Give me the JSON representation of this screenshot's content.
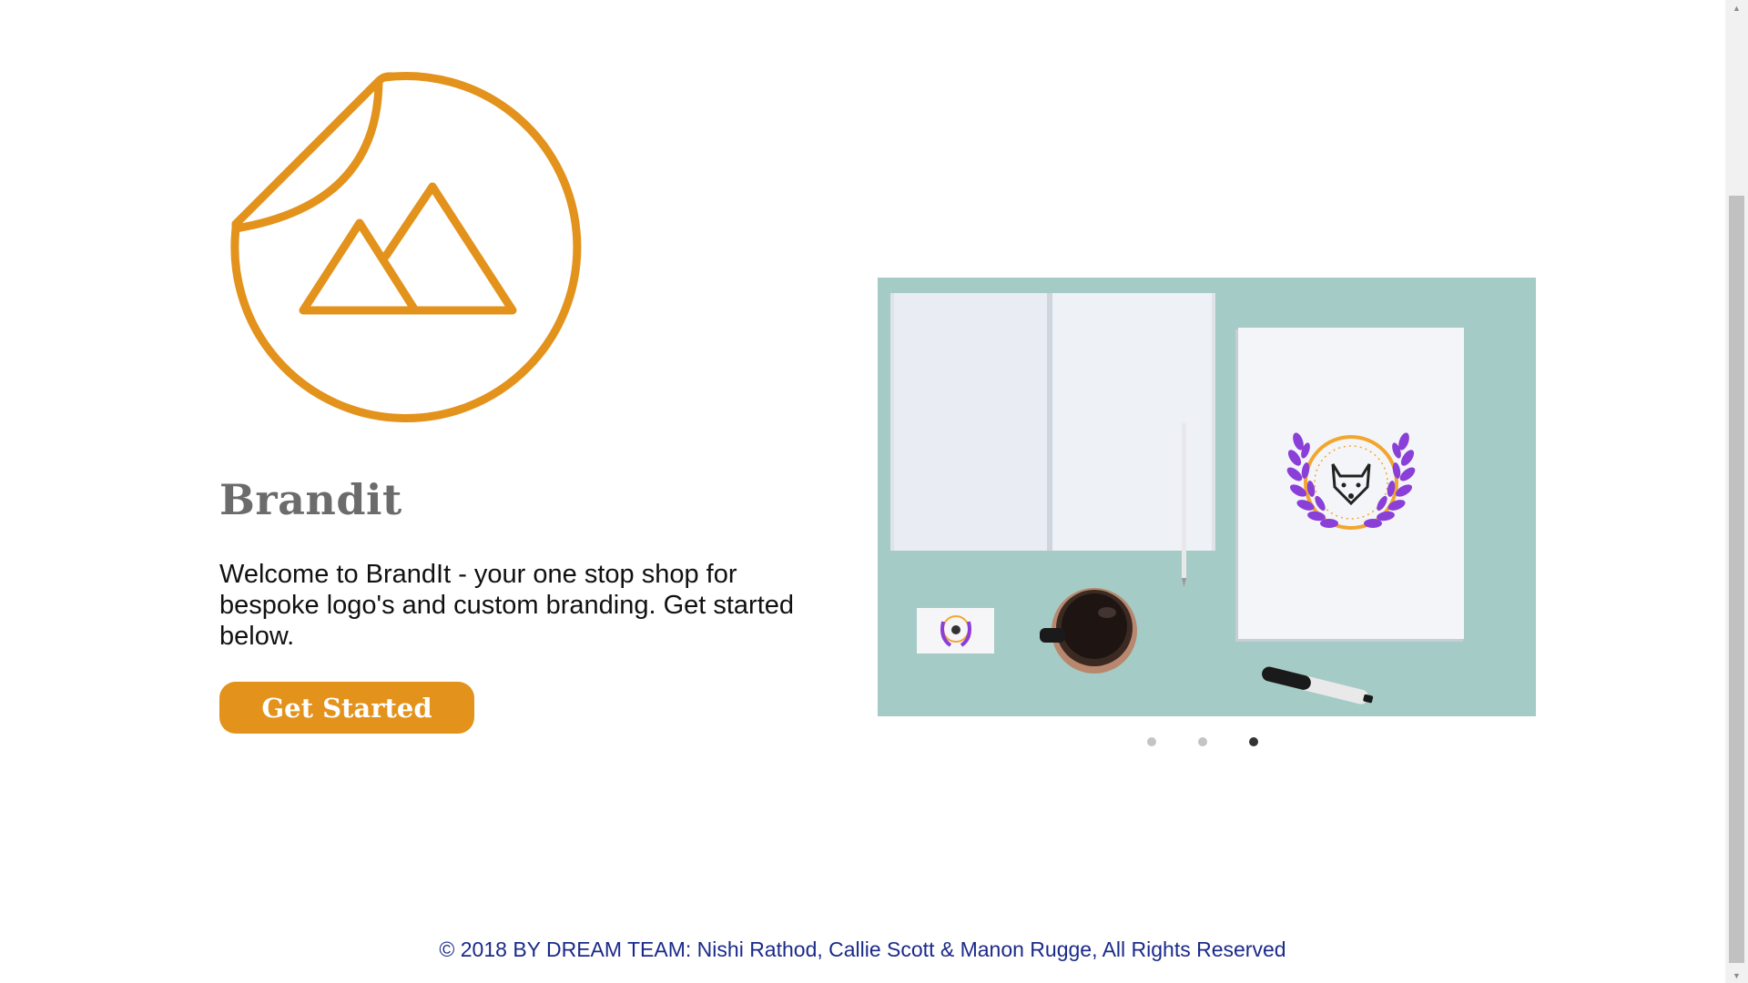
{
  "brand": {
    "title": "Brandit",
    "logo_icon": "sticker-mountain-icon",
    "accent_color": "#e3921b"
  },
  "hero": {
    "welcome_text": "Welcome to BrandIt - your one stop shop for bespoke logo's and custom branding. Get started below.",
    "cta_label": "Get Started"
  },
  "carousel": {
    "slide_count": 3,
    "active_index": 2,
    "slide_description_icon": "stationery-mockup-image"
  },
  "footer": {
    "text": "© 2018 BY DREAM TEAM: Nishi Rathod, Callie Scott & Manon Rugge, All Rights Reserved"
  },
  "scrollbar": {
    "up_icon": "▲",
    "down_icon": "▼"
  }
}
